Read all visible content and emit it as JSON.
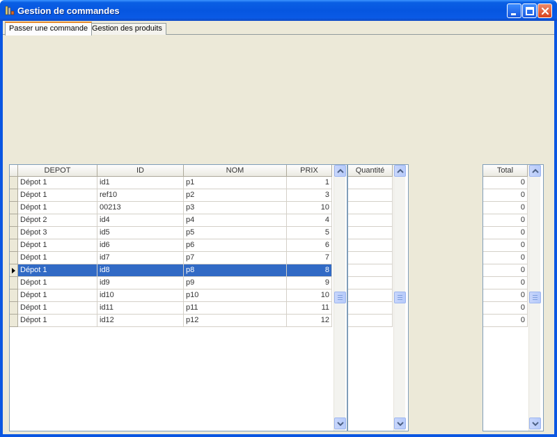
{
  "window": {
    "title": "Gestion de commandes"
  },
  "tabs": [
    {
      "label": "Passer une commande"
    },
    {
      "label": "Gestion des produits"
    }
  ],
  "products_grid": {
    "columns": [
      "DEPOT",
      "ID",
      "NOM",
      "PRIX"
    ],
    "rows": [
      {
        "depot": "Dépot 1",
        "id": "id1",
        "nom": "p1",
        "prix": "1"
      },
      {
        "depot": "Dépot 1",
        "id": "ref10",
        "nom": "p2",
        "prix": "3"
      },
      {
        "depot": "Dépot 1",
        "id": "00213",
        "nom": "p3",
        "prix": "10"
      },
      {
        "depot": "Dépot 2",
        "id": "id4",
        "nom": "p4",
        "prix": "4"
      },
      {
        "depot": "Dépot 3",
        "id": "id5",
        "nom": "p5",
        "prix": "5"
      },
      {
        "depot": "Dépot 1",
        "id": "id6",
        "nom": "p6",
        "prix": "6"
      },
      {
        "depot": "Dépot 1",
        "id": "id7",
        "nom": "p7",
        "prix": "7"
      },
      {
        "depot": "Dépot 1",
        "id": "id8",
        "nom": "p8",
        "prix": "8"
      },
      {
        "depot": "Dépot 1",
        "id": "id9",
        "nom": "p9",
        "prix": "9"
      },
      {
        "depot": "Dépot 1",
        "id": "id10",
        "nom": "p10",
        "prix": "10"
      },
      {
        "depot": "Dépot 1",
        "id": "id11",
        "nom": "p11",
        "prix": "11"
      },
      {
        "depot": "Dépot 1",
        "id": "id12",
        "nom": "p12",
        "prix": "12"
      }
    ],
    "selected_row": 8
  },
  "quantity_grid": {
    "header": "Quantité"
  },
  "total_grid": {
    "header": "Total",
    "values": [
      "0",
      "0",
      "0",
      "0",
      "0",
      "0",
      "0",
      "0",
      "0",
      "0",
      "0",
      "0"
    ]
  },
  "colors": {
    "selection": "#316ac5",
    "title_bar": "#0a56e2",
    "background": "#ece9d8"
  }
}
